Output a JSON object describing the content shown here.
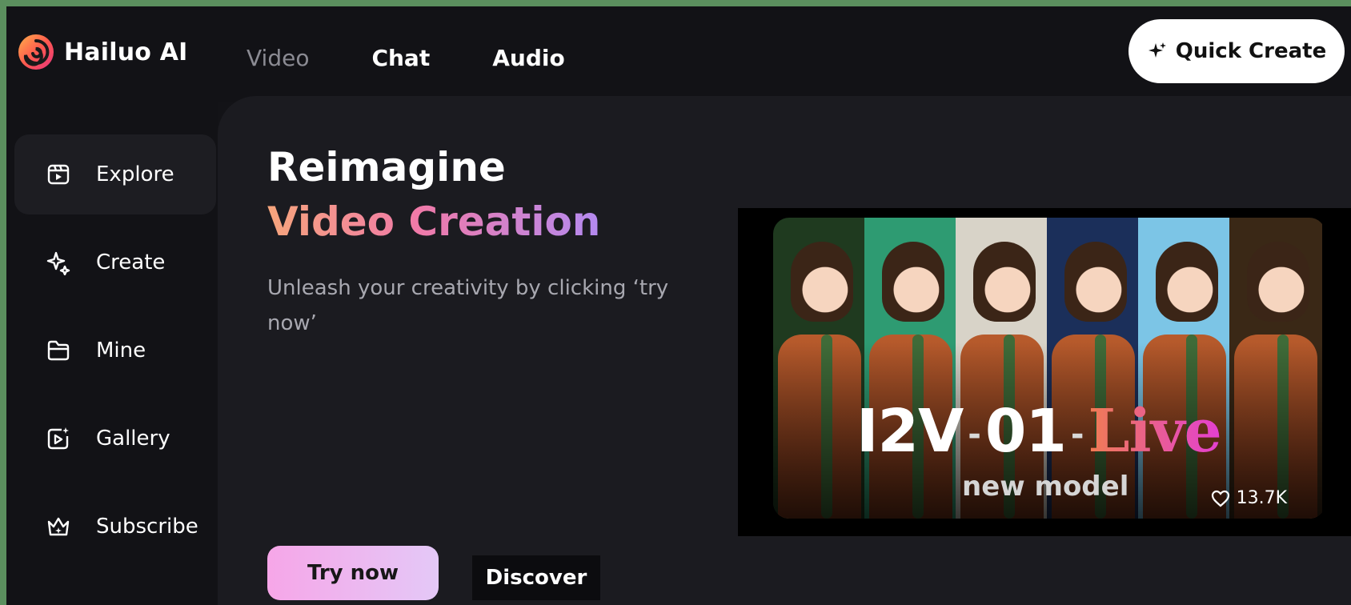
{
  "brand": {
    "title": "Hailuo AI",
    "logo_icon": "hailuo-logo-icon"
  },
  "nav": {
    "tabs": [
      {
        "label": "Video",
        "active": false
      },
      {
        "label": "Chat",
        "active": true
      },
      {
        "label": "Audio",
        "active": true
      }
    ],
    "quick_create_label": "Quick Create",
    "quick_create_icon": "sparkle-icon"
  },
  "sidebar": {
    "items": [
      {
        "label": "Explore",
        "icon": "explore-icon",
        "active": true
      },
      {
        "label": "Create",
        "icon": "sparkle-create-icon",
        "active": false
      },
      {
        "label": "Mine",
        "icon": "folder-icon",
        "active": false
      },
      {
        "label": "Gallery",
        "icon": "gallery-icon",
        "active": false
      },
      {
        "label": "Subscribe",
        "icon": "crown-icon",
        "active": false
      }
    ]
  },
  "hero": {
    "title": "Reimagine",
    "subtitle": "Video Creation",
    "description": "Unleash your creativity by clicking ‘try now’",
    "try_label": "Try now",
    "discover_label": "Discover"
  },
  "media": {
    "model_part1": "I2V",
    "model_part2": "01",
    "model_part3": "Live",
    "hyphen": "-",
    "model_sub": "new model",
    "likes": "13.7K",
    "strip_colors": [
      "#1f3a1f",
      "#2e9b72",
      "#d8d3c8",
      "#1b2f5a",
      "#7cc5e6",
      "#3a2816"
    ]
  },
  "colors": {
    "background": "#131317",
    "panel": "#1b1b20",
    "accent_gradient_start": "#f6a57c",
    "accent_gradient_end": "#b48af0"
  }
}
